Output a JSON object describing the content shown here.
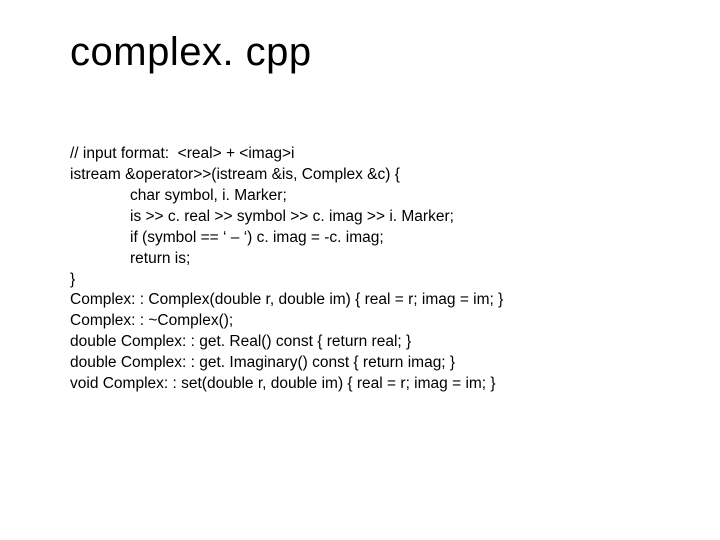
{
  "title": "complex. cpp",
  "code": {
    "l1": "// input format:  <real> + <imag>i",
    "l2": "istream &operator>>(istream &is, Complex &c) {",
    "l3": "char symbol, i. Marker;",
    "l4": "is >> c. real >> symbol >> c. imag >> i. Marker;",
    "l5": "if (symbol == ‘ – ‘) c. imag = -c. imag;",
    "l6": "return is;",
    "l7": "}",
    "l8": "Complex: : Complex(double r, double im) { real = r; imag = im; }",
    "l9": "Complex: : ~Complex();",
    "l10": "double Complex: : get. Real() const { return real; }",
    "l11": "double Complex: : get. Imaginary() const { return imag; }",
    "l12": "void Complex: : set(double r, double im) { real = r; imag = im; }"
  }
}
